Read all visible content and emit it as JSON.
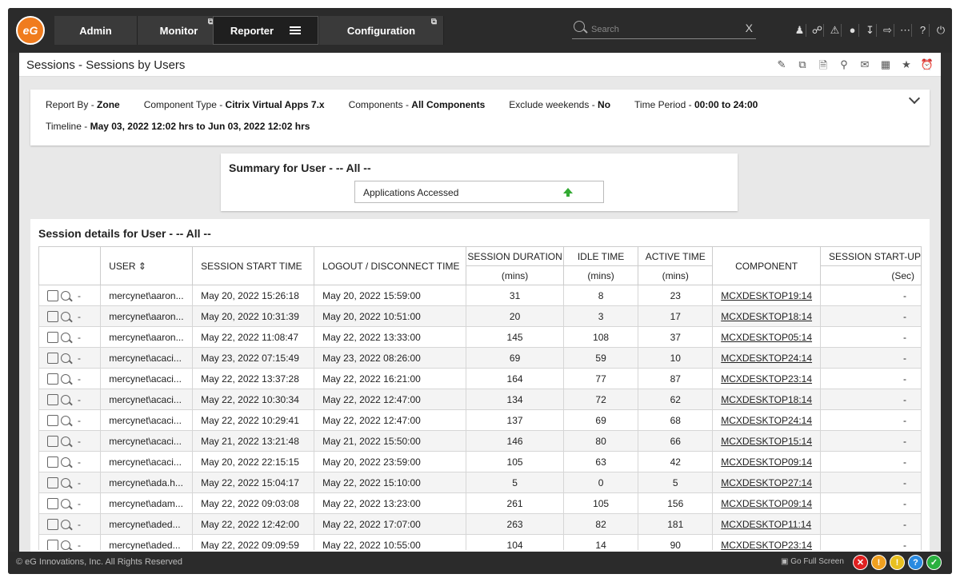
{
  "nav": {
    "logo_text": "eG",
    "tabs": [
      {
        "label": "Admin"
      },
      {
        "label": "Monitor",
        "external_icon": "⧉"
      },
      {
        "label": "Reporter"
      },
      {
        "label": "Configuration",
        "external_icon": "⧉"
      }
    ],
    "search_placeholder": "Search",
    "search_clear": "X",
    "icons": [
      "user-icon",
      "link-icon",
      "alert-icon",
      "bell-icon",
      "download-icon",
      "login-icon",
      "more-icon",
      "help-icon",
      "power-icon"
    ]
  },
  "page": {
    "title": "Sessions - Sessions by Users",
    "toolbar_icons": [
      "edit-report-icon",
      "copy-report-icon",
      "export-pdf-icon",
      "search-report-icon",
      "mail-icon",
      "excel-icon",
      "star-icon",
      "alarm-icon"
    ]
  },
  "filter": {
    "report_by_label": "Report By - ",
    "report_by_value": "Zone",
    "component_type_label": "Component Type - ",
    "component_type_value": "Citrix Virtual Apps 7.x",
    "components_label": "Components - ",
    "components_value": "All Components",
    "exclude_weekends_label": "Exclude weekends - ",
    "exclude_weekends_value": "No",
    "time_period_label": "Time Period - ",
    "time_period_value": "00:00 to 24:00",
    "timeline_label": "Timeline - ",
    "timeline_value": "May 03, 2022 12:02 hrs to Jun 03, 2022 12:02 hrs"
  },
  "summary": {
    "heading": "Summary for User - -- All --",
    "item_label": "Applications Accessed",
    "trend_color": "#33aa33"
  },
  "details": {
    "heading": "Session details for User - -- All --",
    "columns": {
      "user": "USER",
      "start": "SESSION START TIME",
      "logout": "LOGOUT / DISCONNECT TIME",
      "duration": "SESSION DURATION",
      "duration_unit": "(mins)",
      "idle": "IDLE TIME",
      "idle_unit": "(mins)",
      "active": "ACTIVE TIME",
      "active_unit": "(mins)",
      "component": "COMPONENT",
      "startup": "SESSION START-UP",
      "startup_unit": "(Sec)"
    },
    "rows": [
      {
        "dash": "-",
        "user": "mercynet\\aaron...",
        "start": "May 20, 2022 15:26:18",
        "logout": "May 20, 2022 15:59:00",
        "duration": "31",
        "idle": "8",
        "active": "23",
        "component": "MCXDESKTOP19:14",
        "startup": "-"
      },
      {
        "dash": "-",
        "user": "mercynet\\aaron...",
        "start": "May 20, 2022 10:31:39",
        "logout": "May 20, 2022 10:51:00",
        "duration": "20",
        "idle": "3",
        "active": "17",
        "component": "MCXDESKTOP18:14",
        "startup": "-"
      },
      {
        "dash": "-",
        "user": "mercynet\\aaron...",
        "start": "May 22, 2022 11:08:47",
        "logout": "May 22, 2022 13:33:00",
        "duration": "145",
        "idle": "108",
        "active": "37",
        "component": "MCXDESKTOP05:14",
        "startup": "-"
      },
      {
        "dash": "-",
        "user": "mercynet\\acaci...",
        "start": "May 23, 2022 07:15:49",
        "logout": "May 23, 2022 08:26:00",
        "duration": "69",
        "idle": "59",
        "active": "10",
        "component": "MCXDESKTOP24:14",
        "startup": "-"
      },
      {
        "dash": "-",
        "user": "mercynet\\acaci...",
        "start": "May 22, 2022 13:37:28",
        "logout": "May 22, 2022 16:21:00",
        "duration": "164",
        "idle": "77",
        "active": "87",
        "component": "MCXDESKTOP23:14",
        "startup": "-"
      },
      {
        "dash": "-",
        "user": "mercynet\\acaci...",
        "start": "May 22, 2022 10:30:34",
        "logout": "May 22, 2022 12:47:00",
        "duration": "134",
        "idle": "72",
        "active": "62",
        "component": "MCXDESKTOP18:14",
        "startup": "-"
      },
      {
        "dash": "-",
        "user": "mercynet\\acaci...",
        "start": "May 22, 2022 10:29:41",
        "logout": "May 22, 2022 12:47:00",
        "duration": "137",
        "idle": "69",
        "active": "68",
        "component": "MCXDESKTOP24:14",
        "startup": "-"
      },
      {
        "dash": "-",
        "user": "mercynet\\acaci...",
        "start": "May 21, 2022 13:21:48",
        "logout": "May 21, 2022 15:50:00",
        "duration": "146",
        "idle": "80",
        "active": "66",
        "component": "MCXDESKTOP15:14",
        "startup": "-"
      },
      {
        "dash": "-",
        "user": "mercynet\\acaci...",
        "start": "May 20, 2022 22:15:15",
        "logout": "May 20, 2022 23:59:00",
        "duration": "105",
        "idle": "63",
        "active": "42",
        "component": "MCXDESKTOP09:14",
        "startup": "-"
      },
      {
        "dash": "-",
        "user": "mercynet\\ada.h...",
        "start": "May 22, 2022 15:04:17",
        "logout": "May 22, 2022 15:10:00",
        "duration": "5",
        "idle": "0",
        "active": "5",
        "component": "MCXDESKTOP27:14",
        "startup": "-"
      },
      {
        "dash": "-",
        "user": "mercynet\\adam...",
        "start": "May 22, 2022 09:03:08",
        "logout": "May 22, 2022 13:23:00",
        "duration": "261",
        "idle": "105",
        "active": "156",
        "component": "MCXDESKTOP09:14",
        "startup": "-"
      },
      {
        "dash": "-",
        "user": "mercynet\\aded...",
        "start": "May 22, 2022 12:42:00",
        "logout": "May 22, 2022 17:07:00",
        "duration": "263",
        "idle": "82",
        "active": "181",
        "component": "MCXDESKTOP11:14",
        "startup": "-"
      },
      {
        "dash": "-",
        "user": "mercynet\\aded...",
        "start": "May 22, 2022 09:09:59",
        "logout": "May 22, 2022 10:55:00",
        "duration": "104",
        "idle": "14",
        "active": "90",
        "component": "MCXDESKTOP23:14",
        "startup": "-"
      }
    ]
  },
  "footer": {
    "copyright": "© eG Innovations, Inc. All Rights Reserved",
    "full_screen": "Go Full Screen",
    "status_circles": [
      {
        "glyph": "✕",
        "color": "#e02020"
      },
      {
        "glyph": "!",
        "color": "#f0a020"
      },
      {
        "glyph": "!",
        "color": "#e8c020"
      },
      {
        "glyph": "?",
        "color": "#2a8ae0"
      },
      {
        "glyph": "✓",
        "color": "#2ab040"
      }
    ]
  }
}
